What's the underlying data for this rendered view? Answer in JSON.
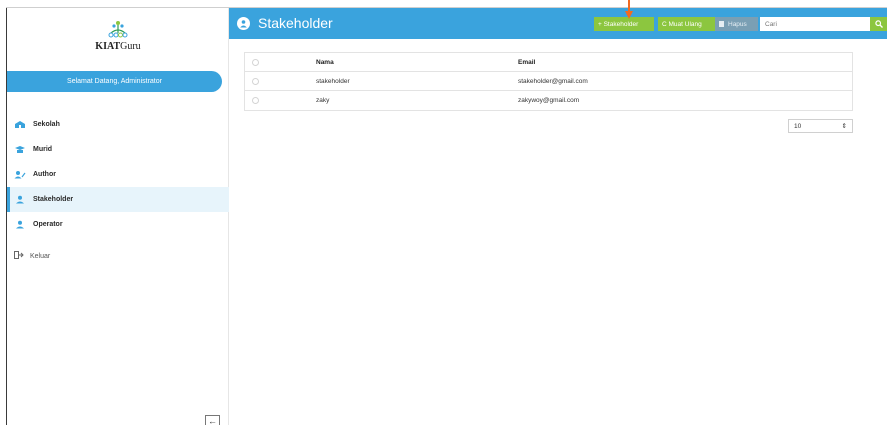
{
  "app": {
    "logo_text_bold": "KIAT",
    "logo_text_rest": "Guru"
  },
  "sidebar": {
    "welcome": "Selamat Datang, Administrator",
    "items": [
      {
        "label": "Sekolah",
        "icon": "school-icon",
        "active": false
      },
      {
        "label": "Murid",
        "icon": "student-icon",
        "active": false
      },
      {
        "label": "Author",
        "icon": "author-icon",
        "active": false
      },
      {
        "label": "Stakeholder",
        "icon": "user-icon",
        "active": true
      },
      {
        "label": "Operator",
        "icon": "user-icon",
        "active": false
      }
    ],
    "logout": "Keluar",
    "collapse_glyph": "←"
  },
  "header": {
    "title": "Stakeholder",
    "add_label": "+ Stakeholder",
    "reload_label": "C Muat Ulang",
    "delete_label": "Hapus",
    "search_placeholder": "Cari"
  },
  "table": {
    "columns": [
      "Nama",
      "Email"
    ],
    "rows": [
      {
        "nama": "stakeholder",
        "email": "stakeholder@gmail.com"
      },
      {
        "nama": "zaky",
        "email": "zakywoy@gmail.com"
      }
    ]
  },
  "pagination": {
    "page_size": "10",
    "glyph": "⇕"
  },
  "colors": {
    "primary": "#3aa3dd",
    "success": "#8cc63f",
    "muted": "#7a9fb4",
    "annotation_arrow": "#f26a21"
  }
}
